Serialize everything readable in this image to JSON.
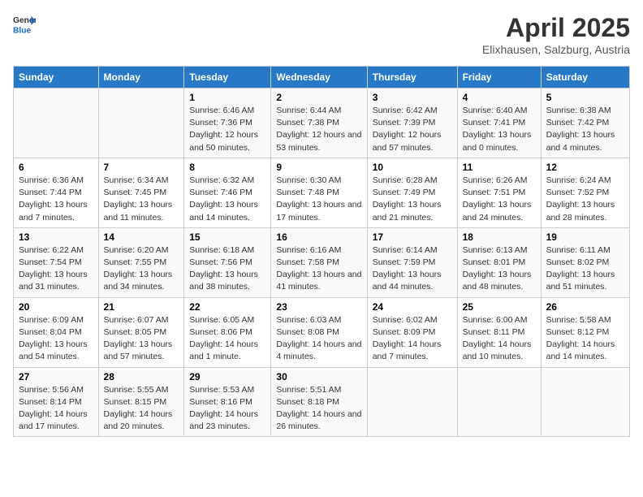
{
  "header": {
    "logo_line1": "General",
    "logo_line2": "Blue",
    "title": "April 2025",
    "subtitle": "Elixhausen, Salzburg, Austria"
  },
  "days_of_week": [
    "Sunday",
    "Monday",
    "Tuesday",
    "Wednesday",
    "Thursday",
    "Friday",
    "Saturday"
  ],
  "weeks": [
    [
      {
        "day": "",
        "detail": ""
      },
      {
        "day": "",
        "detail": ""
      },
      {
        "day": "1",
        "detail": "Sunrise: 6:46 AM\nSunset: 7:36 PM\nDaylight: 12 hours and 50 minutes."
      },
      {
        "day": "2",
        "detail": "Sunrise: 6:44 AM\nSunset: 7:38 PM\nDaylight: 12 hours and 53 minutes."
      },
      {
        "day": "3",
        "detail": "Sunrise: 6:42 AM\nSunset: 7:39 PM\nDaylight: 12 hours and 57 minutes."
      },
      {
        "day": "4",
        "detail": "Sunrise: 6:40 AM\nSunset: 7:41 PM\nDaylight: 13 hours and 0 minutes."
      },
      {
        "day": "5",
        "detail": "Sunrise: 6:38 AM\nSunset: 7:42 PM\nDaylight: 13 hours and 4 minutes."
      }
    ],
    [
      {
        "day": "6",
        "detail": "Sunrise: 6:36 AM\nSunset: 7:44 PM\nDaylight: 13 hours and 7 minutes."
      },
      {
        "day": "7",
        "detail": "Sunrise: 6:34 AM\nSunset: 7:45 PM\nDaylight: 13 hours and 11 minutes."
      },
      {
        "day": "8",
        "detail": "Sunrise: 6:32 AM\nSunset: 7:46 PM\nDaylight: 13 hours and 14 minutes."
      },
      {
        "day": "9",
        "detail": "Sunrise: 6:30 AM\nSunset: 7:48 PM\nDaylight: 13 hours and 17 minutes."
      },
      {
        "day": "10",
        "detail": "Sunrise: 6:28 AM\nSunset: 7:49 PM\nDaylight: 13 hours and 21 minutes."
      },
      {
        "day": "11",
        "detail": "Sunrise: 6:26 AM\nSunset: 7:51 PM\nDaylight: 13 hours and 24 minutes."
      },
      {
        "day": "12",
        "detail": "Sunrise: 6:24 AM\nSunset: 7:52 PM\nDaylight: 13 hours and 28 minutes."
      }
    ],
    [
      {
        "day": "13",
        "detail": "Sunrise: 6:22 AM\nSunset: 7:54 PM\nDaylight: 13 hours and 31 minutes."
      },
      {
        "day": "14",
        "detail": "Sunrise: 6:20 AM\nSunset: 7:55 PM\nDaylight: 13 hours and 34 minutes."
      },
      {
        "day": "15",
        "detail": "Sunrise: 6:18 AM\nSunset: 7:56 PM\nDaylight: 13 hours and 38 minutes."
      },
      {
        "day": "16",
        "detail": "Sunrise: 6:16 AM\nSunset: 7:58 PM\nDaylight: 13 hours and 41 minutes."
      },
      {
        "day": "17",
        "detail": "Sunrise: 6:14 AM\nSunset: 7:59 PM\nDaylight: 13 hours and 44 minutes."
      },
      {
        "day": "18",
        "detail": "Sunrise: 6:13 AM\nSunset: 8:01 PM\nDaylight: 13 hours and 48 minutes."
      },
      {
        "day": "19",
        "detail": "Sunrise: 6:11 AM\nSunset: 8:02 PM\nDaylight: 13 hours and 51 minutes."
      }
    ],
    [
      {
        "day": "20",
        "detail": "Sunrise: 6:09 AM\nSunset: 8:04 PM\nDaylight: 13 hours and 54 minutes."
      },
      {
        "day": "21",
        "detail": "Sunrise: 6:07 AM\nSunset: 8:05 PM\nDaylight: 13 hours and 57 minutes."
      },
      {
        "day": "22",
        "detail": "Sunrise: 6:05 AM\nSunset: 8:06 PM\nDaylight: 14 hours and 1 minute."
      },
      {
        "day": "23",
        "detail": "Sunrise: 6:03 AM\nSunset: 8:08 PM\nDaylight: 14 hours and 4 minutes."
      },
      {
        "day": "24",
        "detail": "Sunrise: 6:02 AM\nSunset: 8:09 PM\nDaylight: 14 hours and 7 minutes."
      },
      {
        "day": "25",
        "detail": "Sunrise: 6:00 AM\nSunset: 8:11 PM\nDaylight: 14 hours and 10 minutes."
      },
      {
        "day": "26",
        "detail": "Sunrise: 5:58 AM\nSunset: 8:12 PM\nDaylight: 14 hours and 14 minutes."
      }
    ],
    [
      {
        "day": "27",
        "detail": "Sunrise: 5:56 AM\nSunset: 8:14 PM\nDaylight: 14 hours and 17 minutes."
      },
      {
        "day": "28",
        "detail": "Sunrise: 5:55 AM\nSunset: 8:15 PM\nDaylight: 14 hours and 20 minutes."
      },
      {
        "day": "29",
        "detail": "Sunrise: 5:53 AM\nSunset: 8:16 PM\nDaylight: 14 hours and 23 minutes."
      },
      {
        "day": "30",
        "detail": "Sunrise: 5:51 AM\nSunset: 8:18 PM\nDaylight: 14 hours and 26 minutes."
      },
      {
        "day": "",
        "detail": ""
      },
      {
        "day": "",
        "detail": ""
      },
      {
        "day": "",
        "detail": ""
      }
    ]
  ]
}
